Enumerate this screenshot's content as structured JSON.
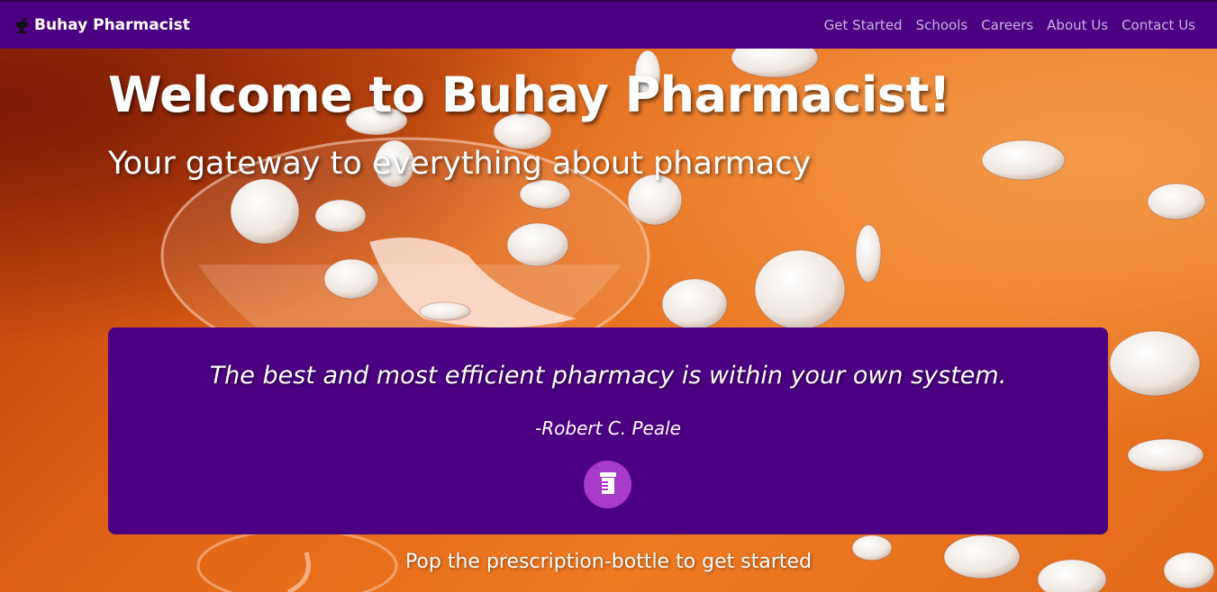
{
  "nav": {
    "brand": "Buhay Pharmacist",
    "brand_icon": "mortar-pestle-icon",
    "links": [
      "Get Started",
      "Schools",
      "Careers",
      "About Us",
      "Contact Us"
    ]
  },
  "hero": {
    "title": "Welcome to Buhay Pharmacist!",
    "subtitle": "Your gateway to everything about pharmacy",
    "background": "orange background with scattered white pills and a wine glass"
  },
  "quote": {
    "text": "The best and most efficient pharmacy is within your own system.",
    "author": "-Robert C. Peale",
    "button_icon": "prescription-bottle-icon"
  },
  "cta": "Pop the prescription-bottle to get started",
  "colors": {
    "nav_bg": "#4b0082",
    "quote_bg": "#4b0082",
    "button_bg": "#a73cc6",
    "hero_orange": "#e06416"
  }
}
